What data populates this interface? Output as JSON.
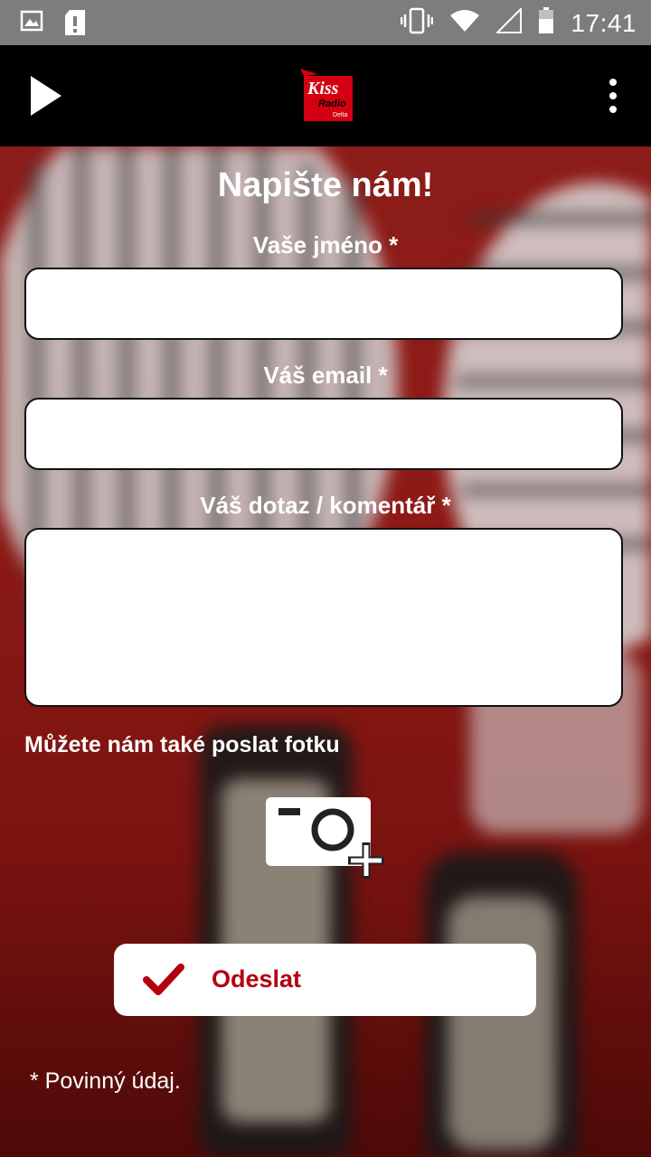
{
  "status_bar": {
    "time": "17:41",
    "icons": [
      "image-icon",
      "sd-card-alert-icon",
      "vibrate-icon",
      "wifi-icon",
      "signal-icon",
      "battery-icon"
    ]
  },
  "app_bar": {
    "play_icon": "play-icon",
    "logo": {
      "line1": "Kiss",
      "line2": "Radio",
      "line3": "Delta"
    },
    "menu_icon": "more-vert-icon"
  },
  "form": {
    "title": "Napište nám!",
    "name_label": "Vaše jméno *",
    "name_value": "",
    "email_label": "Váš email *",
    "email_value": "",
    "comment_label": "Váš dotaz / komentář *",
    "comment_value": "",
    "photo_label": "Můžete nám také poslat fotku",
    "photo_icon": "add-photo-camera-icon",
    "submit_label": "Odeslat",
    "submit_icon": "check-icon",
    "required_note": "* Povinný údaj."
  },
  "colors": {
    "accent": "#b3000f",
    "app_bar": "#000000",
    "status_bar": "#7d7d7d",
    "background": "#8c1c19"
  }
}
